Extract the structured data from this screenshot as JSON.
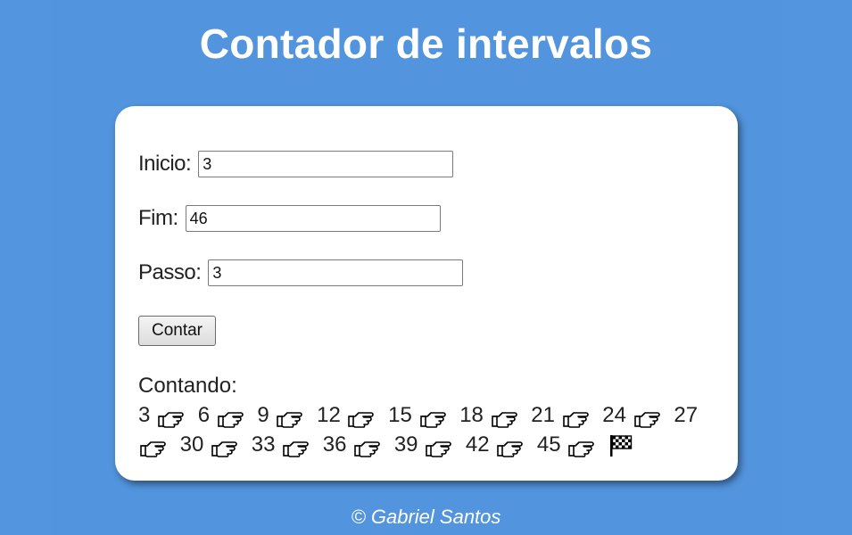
{
  "page": {
    "title": "Contador de intervalos",
    "footer": "© Gabriel Santos"
  },
  "form": {
    "start_label": "Inicio:",
    "start_value": "3",
    "end_label": "Fim:",
    "end_value": "46",
    "step_label": "Passo:",
    "step_value": "3",
    "button_label": "Contar"
  },
  "result": {
    "heading": "Contando:",
    "numbers": [
      "3",
      "6",
      "9",
      "12",
      "15",
      "18",
      "21",
      "24",
      "27",
      "30",
      "33",
      "36",
      "39",
      "42",
      "45"
    ],
    "separator_icon": "pointing-hand-icon",
    "end_icon": "checkered-flag-icon"
  },
  "colors": {
    "background": "#5294dd",
    "card": "#ffffff",
    "title_text": "#ffffff"
  }
}
